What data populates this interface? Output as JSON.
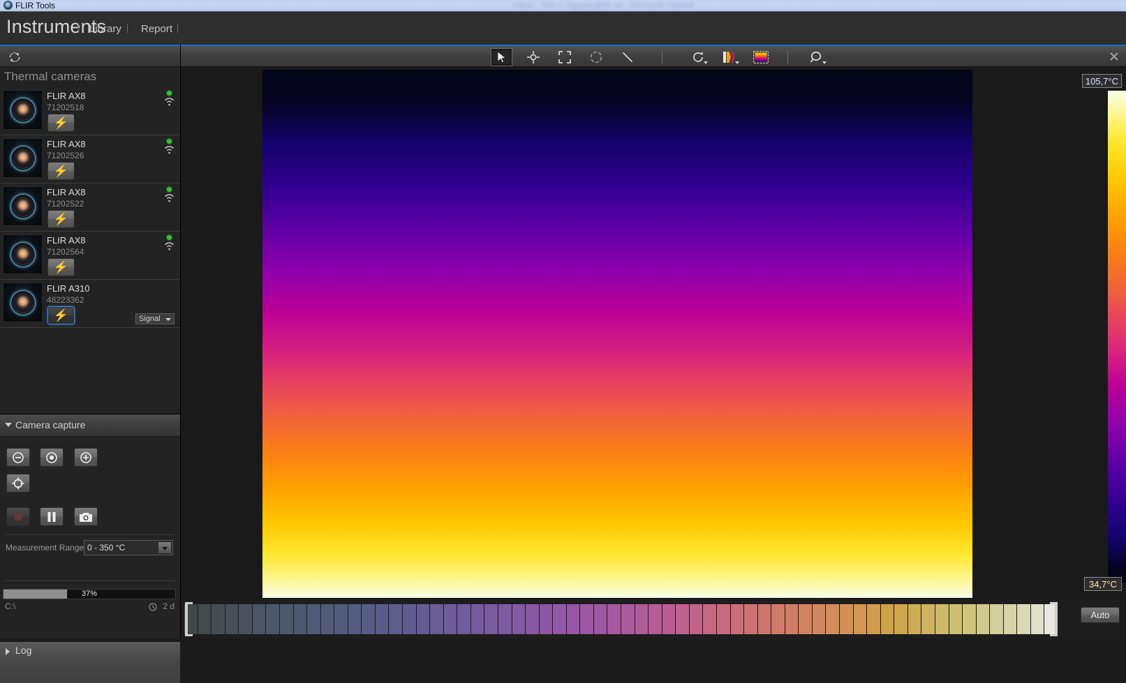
{
  "window": {
    "app_icon": "flir-logo-icon",
    "title": "FLIR Tools",
    "background_window_text": "Inbox - Tom C Nguyen@flir.se - Microsoft Outlook"
  },
  "nav": {
    "active": "Instruments",
    "items": [
      "Library",
      "Report"
    ]
  },
  "left_panel": {
    "refresh_icon": "refresh-icon",
    "section_title": "Thermal cameras",
    "cameras": [
      {
        "name": "FLIR AX8",
        "serial": "71202518",
        "connect_icon": "lightning-bolt-icon",
        "connected": true,
        "wifi_icon": "wifi-icon",
        "status": "online",
        "active": false,
        "signal_label": null
      },
      {
        "name": "FLIR AX8",
        "serial": "71202526",
        "connect_icon": "lightning-bolt-icon",
        "connected": true,
        "wifi_icon": "wifi-icon",
        "status": "online",
        "active": false,
        "signal_label": null
      },
      {
        "name": "FLIR AX8",
        "serial": "71202522",
        "connect_icon": "lightning-bolt-icon",
        "connected": true,
        "wifi_icon": "wifi-icon",
        "status": "online",
        "active": false,
        "signal_label": null
      },
      {
        "name": "FLIR AX8",
        "serial": "71202564",
        "connect_icon": "lightning-bolt-icon",
        "connected": true,
        "wifi_icon": "wifi-icon",
        "status": "online",
        "active": false,
        "signal_label": null
      },
      {
        "name": "FLIR A310",
        "serial": "48223362",
        "connect_icon": "lightning-bolt-icon",
        "connected": true,
        "wifi_icon": null,
        "status": "online",
        "active": true,
        "signal_label": "Signal"
      }
    ]
  },
  "camera_capture": {
    "title": "Camera capture",
    "expanded": true,
    "focus_buttons": [
      {
        "name": "focus-far-button",
        "icon": "minus-circle-icon"
      },
      {
        "name": "focus-auto-button",
        "icon": "target-circle-icon"
      },
      {
        "name": "focus-near-button",
        "icon": "plus-circle-icon"
      }
    ],
    "autofocus_button": {
      "name": "autofocus-button",
      "icon": "crosshair-circle-icon"
    },
    "transport_buttons": [
      {
        "name": "record-button",
        "icon": "record-dot-icon"
      },
      {
        "name": "pause-button",
        "icon": "pause-icon"
      },
      {
        "name": "snapshot-button",
        "icon": "camera-icon"
      }
    ],
    "measurement_range_label": "Measurement Range:",
    "measurement_range_value": "0 - 350 °C",
    "measurement_range_options": [
      "0 - 350 °C"
    ],
    "disk_percent_label": "37%",
    "disk_percent_value": 37,
    "disk_path": "C:\\",
    "disk_time_remaining": "2 d",
    "clock_icon": "clock-icon"
  },
  "log_panel": {
    "title": "Log",
    "expanded": false
  },
  "toolbar": {
    "tools": [
      {
        "name": "select-tool",
        "icon": "cursor-arrow-icon",
        "selected": true,
        "has_caret": false
      },
      {
        "name": "spot-meter-tool",
        "icon": "spot-meter-icon",
        "selected": false,
        "has_caret": false
      },
      {
        "name": "box-area-tool",
        "icon": "box-area-icon",
        "selected": false,
        "has_caret": false
      },
      {
        "name": "circle-area-tool",
        "icon": "circle-area-icon",
        "selected": false,
        "has_caret": false
      },
      {
        "name": "line-tool",
        "icon": "line-icon",
        "selected": false,
        "has_caret": false
      },
      {
        "name": "rotate-tool",
        "icon": "rotate-icon",
        "selected": false,
        "has_caret": true
      },
      {
        "name": "palette-tool",
        "icon": "palette-icon",
        "selected": false,
        "has_caret": true
      },
      {
        "name": "color-range-tool",
        "icon": "color-range-icon",
        "selected": false,
        "has_caret": false
      },
      {
        "name": "zoom-tool",
        "icon": "magnifier-icon",
        "selected": false,
        "has_caret": true
      }
    ],
    "close_icon": "close-icon",
    "accent_color": "#1a6fc4"
  },
  "viewport": {
    "temp_max": "105,7°C",
    "temp_min": "34,7°C",
    "scale_orientation": "vertical",
    "palette_name": "rainbow-hc"
  },
  "bottom_scale": {
    "auto_button_label": "Auto",
    "left_handle_icon": "bracket-left-icon",
    "right_handle_icon": "bracket-right-icon",
    "segments": 64
  }
}
